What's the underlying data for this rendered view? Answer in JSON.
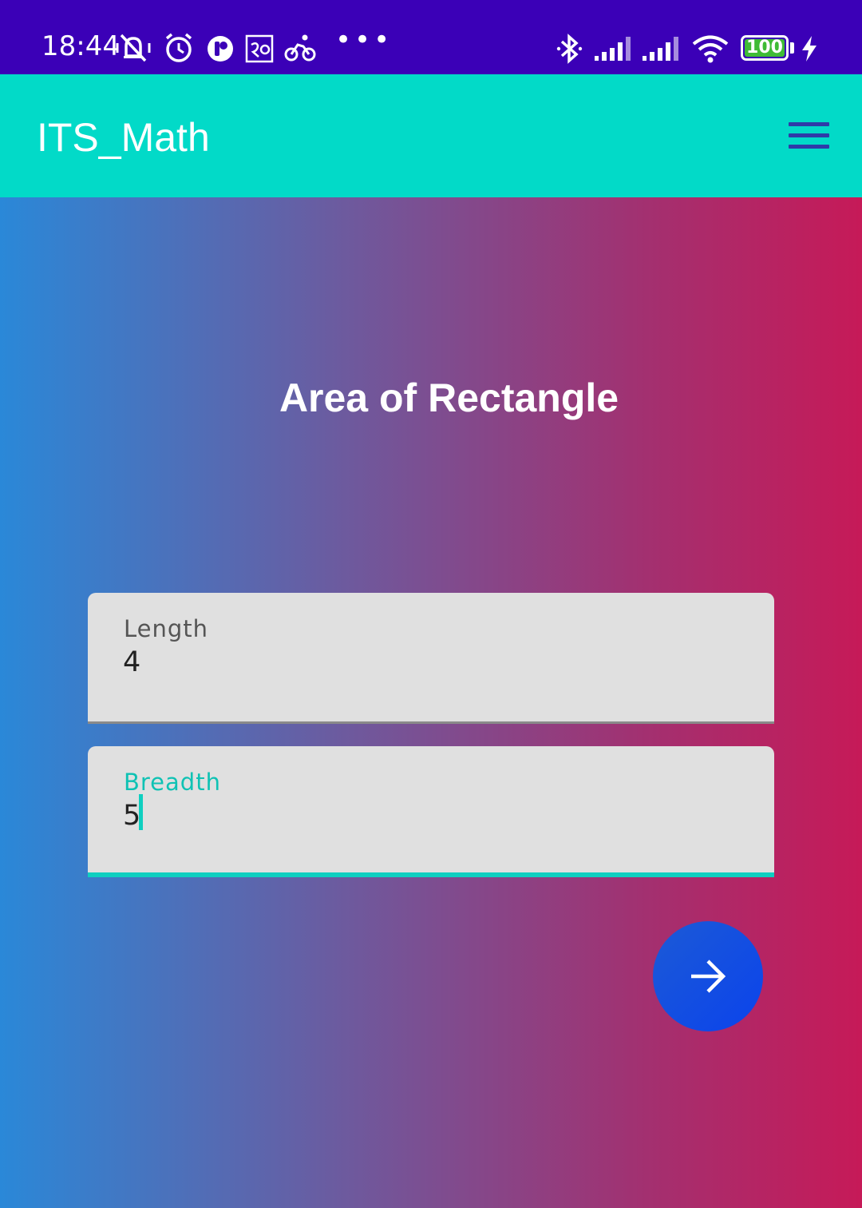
{
  "status_bar": {
    "time": "18:44",
    "battery_level": "100",
    "icons": [
      "mute-vibrate-icon",
      "alarm-icon",
      "app-notification-icon",
      "rupee-app-icon",
      "cycling-icon",
      "more-dots-icon",
      "bluetooth-icon",
      "signal-icon",
      "signal-icon",
      "wifi-icon",
      "battery-icon",
      "charging-icon"
    ],
    "more_indicator": "•••"
  },
  "app_bar": {
    "title": "ITS_Math",
    "menu_icon": "hamburger-menu-icon",
    "background_color": "#02dac8"
  },
  "main": {
    "heading": "Area of Rectangle",
    "fields": [
      {
        "label": "Length",
        "value": "4"
      },
      {
        "label": "Breadth",
        "value": "5"
      }
    ],
    "submit_icon": "arrow-right-icon"
  },
  "colors": {
    "status_bar": "#3b00b7",
    "accent": "#0fcfc0",
    "fab": "#0b43ec",
    "gradient_left": "#2a88d8",
    "gradient_right": "#c61a58"
  }
}
